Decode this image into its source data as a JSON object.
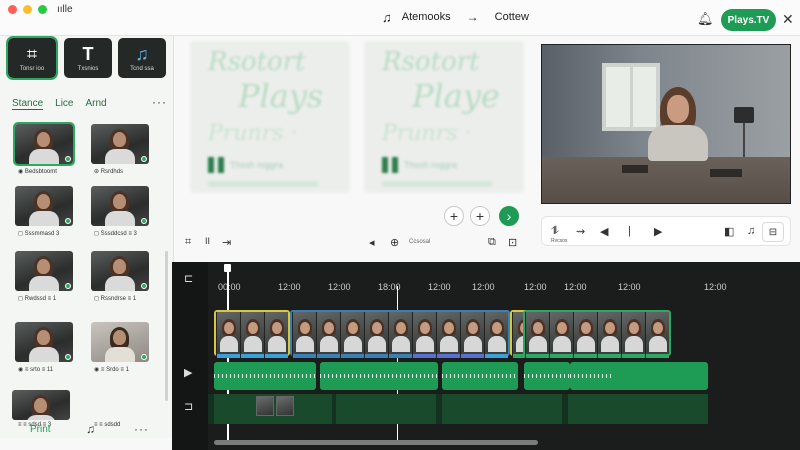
{
  "window": {
    "title": "ıılle",
    "controls": [
      "close",
      "minimize",
      "maximize"
    ],
    "colors": {
      "close": "#ff5f57",
      "minimize": "#febc2e",
      "maximize": "#28c840"
    }
  },
  "header": {
    "breadcrumb_from": "Atemooks",
    "breadcrumb_to": "Cottew",
    "brand_button": "Plays.TV",
    "accent": "#1e9c55"
  },
  "tools": [
    {
      "icon": "hashtag-icon",
      "glyph": "⌗",
      "label": "Tonsr ioo"
    },
    {
      "icon": "text-icon",
      "glyph": "T",
      "label": "Txsnios"
    },
    {
      "icon": "music-icon",
      "glyph": "♫",
      "label": "Tcnd ssa"
    }
  ],
  "tabs": [
    "Stance",
    "Lice",
    "Arnd"
  ],
  "more_glyph": "···",
  "media": [
    {
      "caption": "◉ Bedsbtoomt"
    },
    {
      "caption": "⊛ Rsrdhds"
    },
    {
      "caption": "◻ Sssmmasd  3"
    },
    {
      "caption": "◻ Sssddcsd  ≡ 3"
    },
    {
      "caption": "◻ Rwdssd  ≡ 1"
    },
    {
      "caption": "◻ Rssndrse  ≡ 1"
    },
    {
      "caption": "◉ ≡ srto  ≡ 11"
    },
    {
      "caption": "◉ ≡ Srdo  ≡ 1"
    },
    {
      "caption": "≡ ≡ sdsd  ≡ 3"
    },
    {
      "caption": "≡ ≡ sdsdd"
    }
  ],
  "left_bottom": {
    "print": "Print",
    "music_glyph": "♫",
    "more_glyph": "···"
  },
  "preview_cards": [
    {
      "line1": "Rsotort",
      "line2": "Plays",
      "line3": "Prunrs ·",
      "sub": "Thssh roggra"
    },
    {
      "line1": "Rsotort",
      "line2": "Playe",
      "line3": "Prunrs ·",
      "sub": "Thssh roggra"
    }
  ],
  "center_controls": {
    "add1": "+",
    "add2": "+",
    "next": "›",
    "trim": "⌗",
    "pause": "II",
    "arrow": "⇥",
    "speaker": "◂",
    "plus": "⊕",
    "clock_label": "Ccsosal",
    "copy": "⧉",
    "export": "⊡"
  },
  "player": {
    "split": "⥮",
    "fx": "⇝",
    "volume": "◀",
    "separator": "|",
    "play": "▶",
    "caption_btn": "◧",
    "music": "♫",
    "cast": "⊟",
    "small_label": "Rvcsos"
  },
  "timeline": {
    "track_icons": [
      "⊏",
      "▶",
      "⊐"
    ],
    "ticks": [
      "00:00",
      "12:00",
      "12:00",
      "18:00",
      "12:00",
      "12:00",
      "12:00",
      "12:00",
      "12:00",
      "12:00"
    ],
    "playhead_top": "▮"
  }
}
